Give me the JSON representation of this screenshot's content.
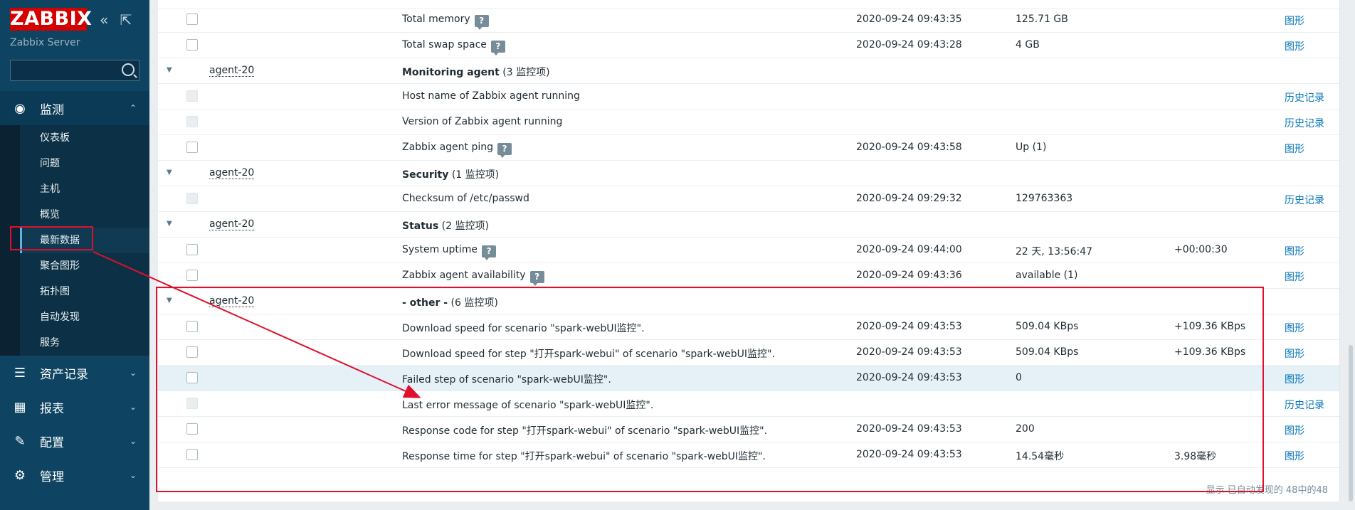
{
  "app": {
    "logo": "ZABBIX",
    "server_name": "Zabbix Server",
    "collapse_icon": "double-chevron-left-icon",
    "fullscreen_icon": "expand-icon"
  },
  "search": {
    "value": "",
    "placeholder": ""
  },
  "nav": {
    "monitoring": "监测",
    "assets": "资产记录",
    "reports": "报表",
    "config": "配置",
    "admin": "管理",
    "sub": [
      "仪表板",
      "问题",
      "主机",
      "概览",
      "最新数据",
      "聚合图形",
      "拓扑图",
      "自动发现",
      "服务"
    ]
  },
  "rows": [
    {
      "type": "item",
      "checkbox": "enabled",
      "name": "Total memory",
      "help": true,
      "time": "2020-09-24 09:43:35",
      "value": "125.71 GB",
      "change": "",
      "action": "图形"
    },
    {
      "type": "item",
      "checkbox": "enabled",
      "name": "Total swap space",
      "help": true,
      "time": "2020-09-24 09:43:28",
      "value": "4 GB",
      "change": "",
      "action": "图形"
    },
    {
      "type": "group",
      "host": "agent-20",
      "name": "Monitoring agent",
      "count": "(3 监控项)"
    },
    {
      "type": "item",
      "checkbox": "disabled",
      "name": "Host name of Zabbix agent running",
      "help": false,
      "time": "",
      "value": "",
      "change": "",
      "action": "历史记录"
    },
    {
      "type": "item",
      "checkbox": "disabled",
      "name": "Version of Zabbix agent running",
      "help": false,
      "time": "",
      "value": "",
      "change": "",
      "action": "历史记录"
    },
    {
      "type": "item",
      "checkbox": "enabled",
      "name": "Zabbix agent ping",
      "help": true,
      "time": "2020-09-24 09:43:58",
      "value": "Up (1)",
      "change": "",
      "action": "图形"
    },
    {
      "type": "group",
      "host": "agent-20",
      "name": "Security",
      "count": "(1 监控项)"
    },
    {
      "type": "item",
      "checkbox": "disabled",
      "name": "Checksum of /etc/passwd",
      "help": false,
      "time": "2020-09-24 09:29:32",
      "value": "129763363",
      "change": "",
      "action": "历史记录"
    },
    {
      "type": "group",
      "host": "agent-20",
      "name": "Status",
      "count": "(2 监控项)"
    },
    {
      "type": "item",
      "checkbox": "enabled",
      "name": "System uptime",
      "help": true,
      "time": "2020-09-24 09:44:00",
      "value": "22 天, 13:56:47",
      "change": "+00:00:30",
      "action": "图形"
    },
    {
      "type": "item",
      "checkbox": "enabled",
      "name": "Zabbix agent availability",
      "help": true,
      "time": "2020-09-24 09:43:36",
      "value": "available (1)",
      "change": "",
      "action": "图形"
    },
    {
      "type": "group",
      "host": "agent-20",
      "name": "- other -",
      "count": "(6 监控项)"
    },
    {
      "type": "item",
      "checkbox": "enabled",
      "name": "Download speed for scenario \"spark-webUI监控\".",
      "help": false,
      "time": "2020-09-24 09:43:53",
      "value": "509.04 KBps",
      "change": "+109.36 KBps",
      "action": "图形"
    },
    {
      "type": "item",
      "checkbox": "enabled",
      "name": "Download speed for step \"打开spark-webui\" of scenario \"spark-webUI监控\".",
      "help": false,
      "time": "2020-09-24 09:43:53",
      "value": "509.04 KBps",
      "change": "+109.36 KBps",
      "action": "图形"
    },
    {
      "type": "item",
      "checkbox": "enabled",
      "name": "Failed step of scenario \"spark-webUI监控\".",
      "help": false,
      "time": "2020-09-24 09:43:53",
      "value": "0",
      "change": "",
      "action": "图形",
      "highlight": true
    },
    {
      "type": "item",
      "checkbox": "disabled",
      "name": "Last error message of scenario \"spark-webUI监控\".",
      "help": false,
      "time": "",
      "value": "",
      "change": "",
      "action": "历史记录"
    },
    {
      "type": "item",
      "checkbox": "enabled",
      "name": "Response code for step \"打开spark-webui\" of scenario \"spark-webUI监控\".",
      "help": false,
      "time": "2020-09-24 09:43:53",
      "value": "200",
      "change": "",
      "action": "图形"
    },
    {
      "type": "item",
      "checkbox": "enabled",
      "name": "Response time for step \"打开spark-webui\" of scenario \"spark-webUI监控\".",
      "help": false,
      "time": "2020-09-24 09:43:53",
      "value": "14.54毫秒",
      "change": "3.98毫秒",
      "action": "图形"
    }
  ],
  "footer": "显示 已自动发现的 48中的48",
  "colors": {
    "sidebar": "#0e4462",
    "accent": "#0275b8",
    "annotation": "#e0102c"
  }
}
